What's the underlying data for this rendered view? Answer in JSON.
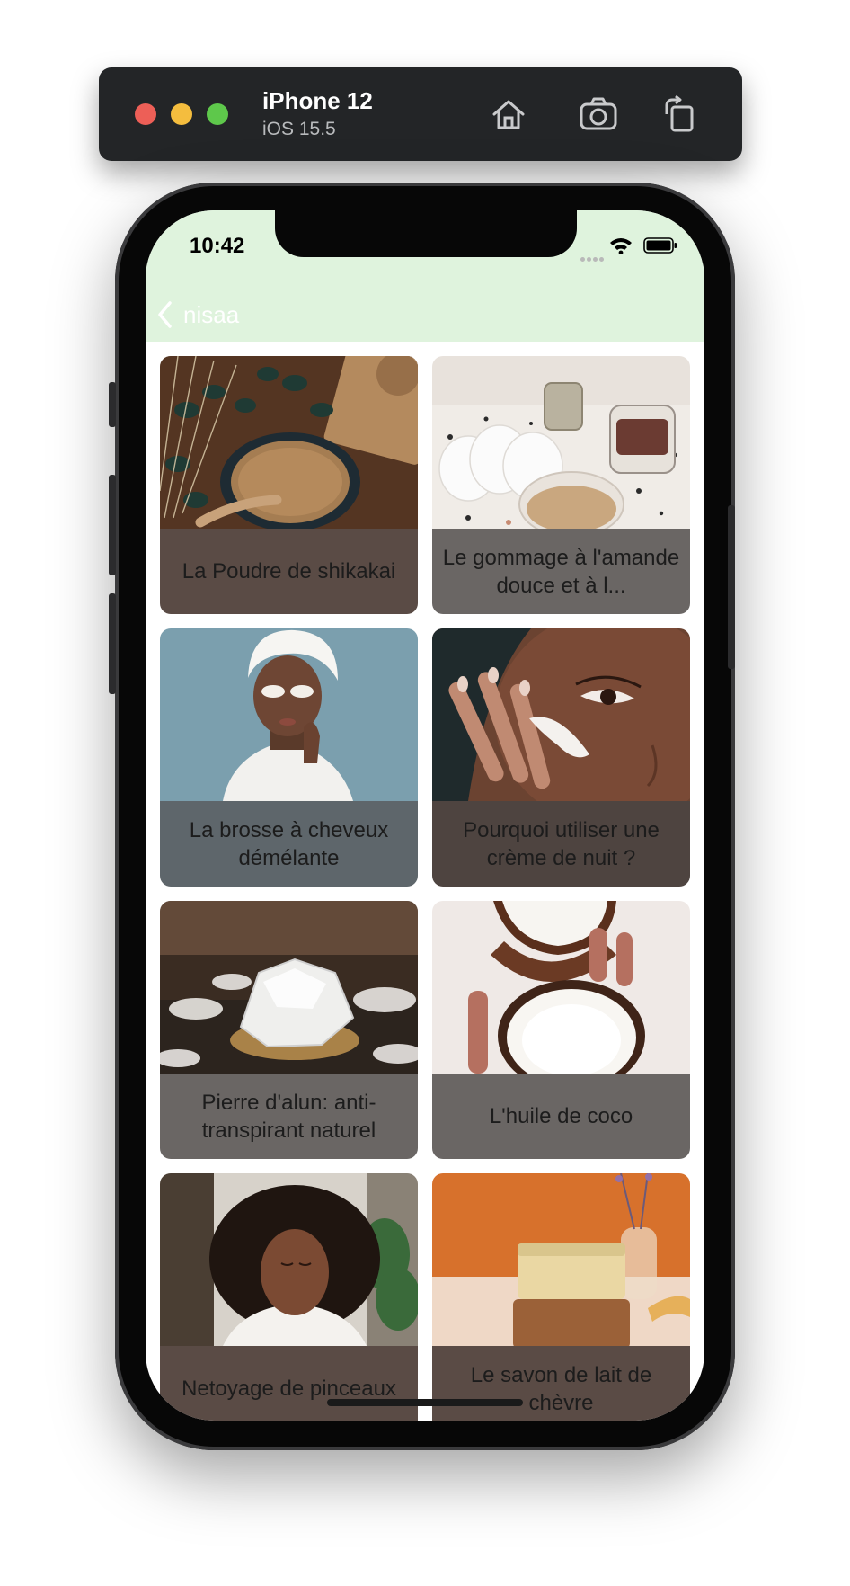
{
  "simulator": {
    "device": "iPhone 12",
    "os": "iOS 15.5"
  },
  "status_bar": {
    "time": "10:42"
  },
  "nav": {
    "back_label": "nisaa"
  },
  "colors": {
    "header_bg": "#dff3dd",
    "nav_text": "#ffffff"
  },
  "cards": [
    {
      "title": "La Poudre de shikakai",
      "image": "shikakai-powder-bowl"
    },
    {
      "title": "Le gommage à l'amande douce et à l...",
      "image": "almond-scrub-jars"
    },
    {
      "title": "La brosse à cheveux démélante",
      "image": "woman-towel-eye-patches"
    },
    {
      "title": "Pourquoi utiliser une crème de nuit ?",
      "image": "face-cream-application"
    },
    {
      "title": "Pierre d'alun: anti-transpirant naturel",
      "image": "alum-stone-crystal"
    },
    {
      "title": "L'huile de coco",
      "image": "coconut-halves"
    },
    {
      "title": "Netoyage de pinceaux",
      "image": "woman-curly-hair"
    },
    {
      "title": "Le savon de lait de chèvre",
      "image": "goat-milk-soap-bars"
    }
  ]
}
